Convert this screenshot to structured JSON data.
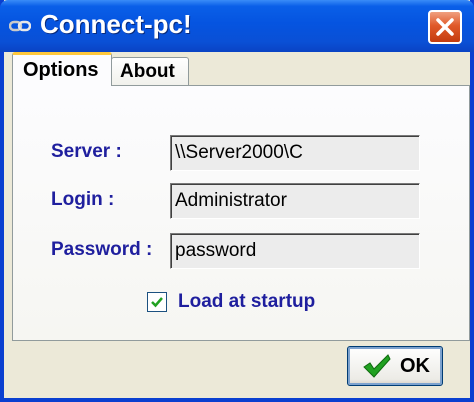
{
  "window": {
    "title": "Connect-pc!",
    "app_icon": "link-chain-icon",
    "close_icon": "close-icon"
  },
  "tabs": [
    {
      "label": "Options",
      "active": true
    },
    {
      "label": "About",
      "active": false
    }
  ],
  "form": {
    "server_label": "Server :",
    "server_value": "\\\\Server2000\\C",
    "login_label": "Login :",
    "login_value": "Administrator",
    "password_label": "Password :",
    "password_value": "password",
    "startup_checkbox": {
      "label": "Load at startup",
      "checked": true
    }
  },
  "buttons": {
    "ok_label": "OK",
    "ok_icon": "checkmark-icon"
  },
  "colors": {
    "titlebar": "#0554e0",
    "label_text": "#1f1f9e",
    "close_button": "#e05a2a",
    "check_green": "#21a121"
  }
}
